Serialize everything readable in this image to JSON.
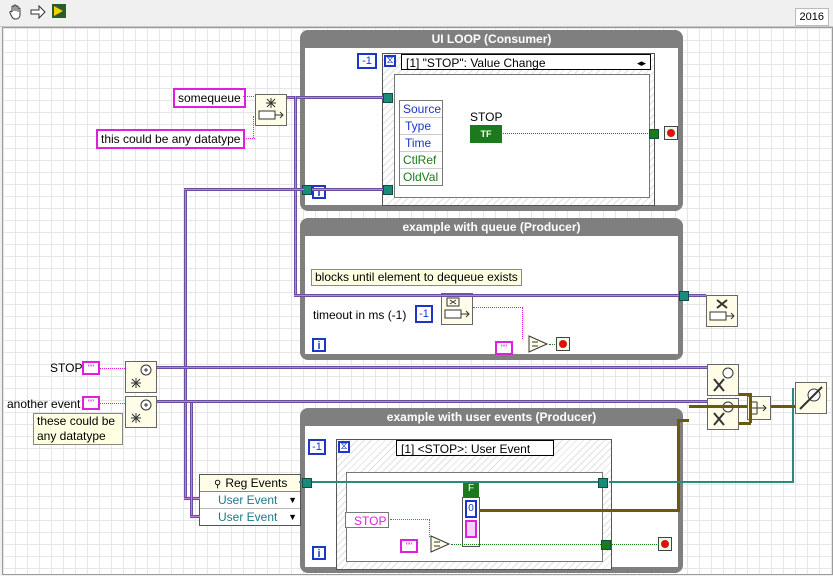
{
  "toolbar": {
    "run_icon": "hand-run-icon",
    "run_cont_icon": "arrow-run-icon",
    "abort_icon": "abort-icon",
    "version": "2016"
  },
  "labels": {
    "somequeue": "somequeue",
    "any_datatype": "this could be any datatype",
    "stop_ctrl": "STOP",
    "another_event": "another event",
    "these_datatype": "these could be any datatype"
  },
  "ui_loop": {
    "title": "UI LOOP (Consumer)",
    "timeout_const": "-1",
    "event_case": "[1] \"STOP\": Value Change",
    "event_data": [
      "Source",
      "Type",
      "Time",
      "CtlRef",
      "OldVal"
    ],
    "stop_terminal_label": "STOP",
    "stop_terminal_text": "TF",
    "iter": "i"
  },
  "queue_loop": {
    "title": "example with queue (Producer)",
    "note": "blocks until element to dequeue exists",
    "timeout_label": "timeout in ms (-1)",
    "timeout_const": "-1",
    "iter": "i"
  },
  "user_loop": {
    "title": "example with user events (Producer)",
    "timeout_const": "-1",
    "event_case": "[1] <STOP>: User Event",
    "stop_label": "STOP",
    "bool_f": "F",
    "bool_0": "0",
    "iter": "i"
  },
  "reg_events": {
    "title": "Reg Events",
    "rows": [
      "User Event",
      "User Event"
    ]
  },
  "colors": {
    "loop_gray": "#7f7f7f",
    "pink": "#e01ee0",
    "blue": "#1c36c7",
    "green": "#1b7a1b"
  }
}
